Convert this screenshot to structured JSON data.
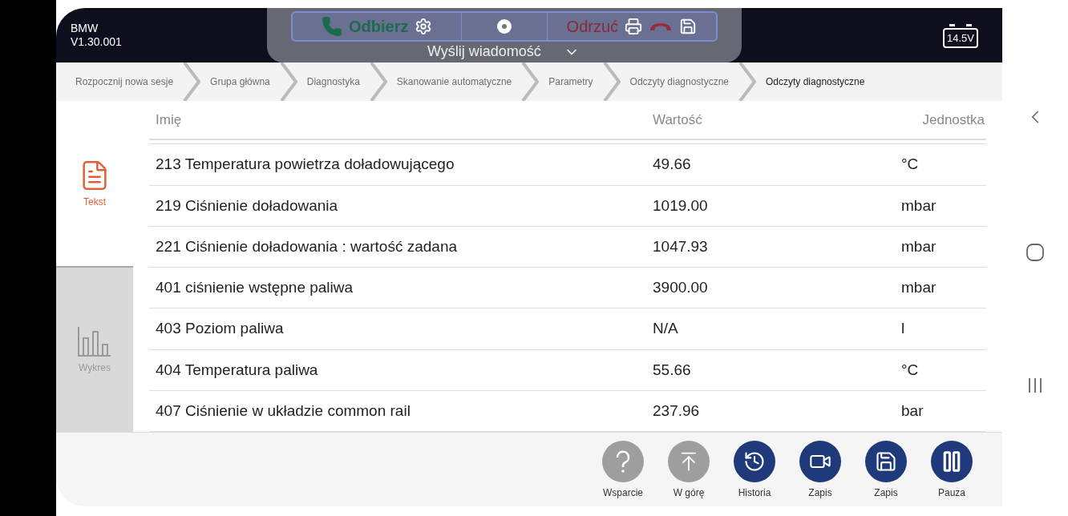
{
  "header": {
    "brand": "BMW",
    "version": "V1.30.001",
    "battery": "14.5V"
  },
  "breadcrumb": [
    {
      "label": "Rozpocznij nowa sesje",
      "selected": false
    },
    {
      "label": "Grupa główna",
      "selected": false
    },
    {
      "label": "Diagnostyka",
      "selected": false
    },
    {
      "label": "Skanowanie automatyczne",
      "selected": false
    },
    {
      "label": "Parametry",
      "selected": false
    },
    {
      "label": "Odczyty diagnostyczne",
      "selected": false
    },
    {
      "label": "Odczyty diagnostyczne",
      "selected": true
    }
  ],
  "call_overlay": {
    "accept": "Odbierz",
    "reject": "Odrzuć",
    "message": "Wyślij wiadomość"
  },
  "side_tabs": [
    {
      "label": "Tekst",
      "kind": "text",
      "selected": true
    },
    {
      "label": "Wykres",
      "kind": "chart",
      "selected": false
    }
  ],
  "table": {
    "columns": [
      "Imię",
      "Wartość",
      "Jednostka"
    ],
    "rows": [
      [
        "213 Temperatura powietrza doładowującego",
        "49.66",
        "°C"
      ],
      [
        "219 Ciśnienie doładowania",
        "1019.00",
        "mbar"
      ],
      [
        "221 Ciśnienie doładowania : wartość zadana",
        "1047.93",
        "mbar"
      ],
      [
        "401 ciśnienie wstępne paliwa",
        "3900.00",
        "mbar"
      ],
      [
        "403 Poziom paliwa",
        "N/A",
        "l"
      ],
      [
        "404 Temperatura paliwa",
        "55.66",
        "°C"
      ],
      [
        "407 Ciśnienie w układzie common rail",
        "237.96",
        "bar"
      ]
    ]
  },
  "toolbar": [
    {
      "label": "Wsparcie",
      "kind": "help",
      "disabled": true
    },
    {
      "label": "W górę",
      "kind": "top",
      "disabled": true
    },
    {
      "label": "Historia",
      "kind": "history",
      "disabled": false
    },
    {
      "label": "Zapis",
      "kind": "record",
      "disabled": false
    },
    {
      "label": "Zapis",
      "kind": "save",
      "disabled": false
    },
    {
      "label": "Pauza",
      "kind": "pause",
      "disabled": false
    }
  ]
}
